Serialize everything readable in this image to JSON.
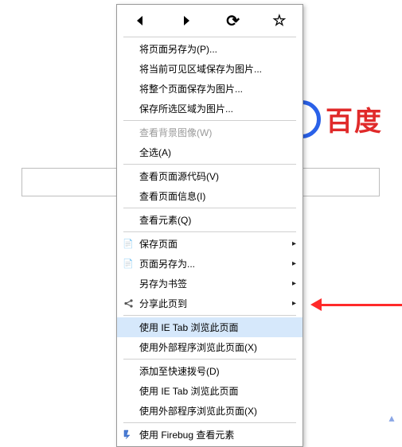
{
  "background": {
    "logo_text": "百度"
  },
  "toolbar": {
    "back": "◄",
    "forward": "►",
    "reload": "⟳",
    "star": "☆"
  },
  "menu": {
    "save_page_as": "将页面另存为(P)...",
    "save_visible_as_image": "将当前可见区域保存为图片...",
    "save_whole_page_as_image": "将整个页面保存为图片...",
    "save_selection_as_image": "保存所选区域为图片...",
    "view_bg_image": "查看背景图像(W)",
    "select_all": "全选(A)",
    "view_source": "查看页面源代码(V)",
    "view_info": "查看页面信息(I)",
    "inspect": "查看元素(Q)",
    "save_page": "保存页面",
    "page_save_as": "页面另存为...",
    "save_as_bookmark": "另存为书签",
    "share_page": "分享此页到",
    "use_ie_tab": "使用 IE Tab 浏览此页面",
    "use_external_1": "使用外部程序浏览此页面(X)",
    "add_to_speed_dial": "添加至快速拨号(D)",
    "use_ie_tab_2": "使用 IE Tab 浏览此页面",
    "use_external_2": "使用外部程序浏览此页面(X)",
    "use_firebug": "使用 Firebug 查看元素"
  }
}
